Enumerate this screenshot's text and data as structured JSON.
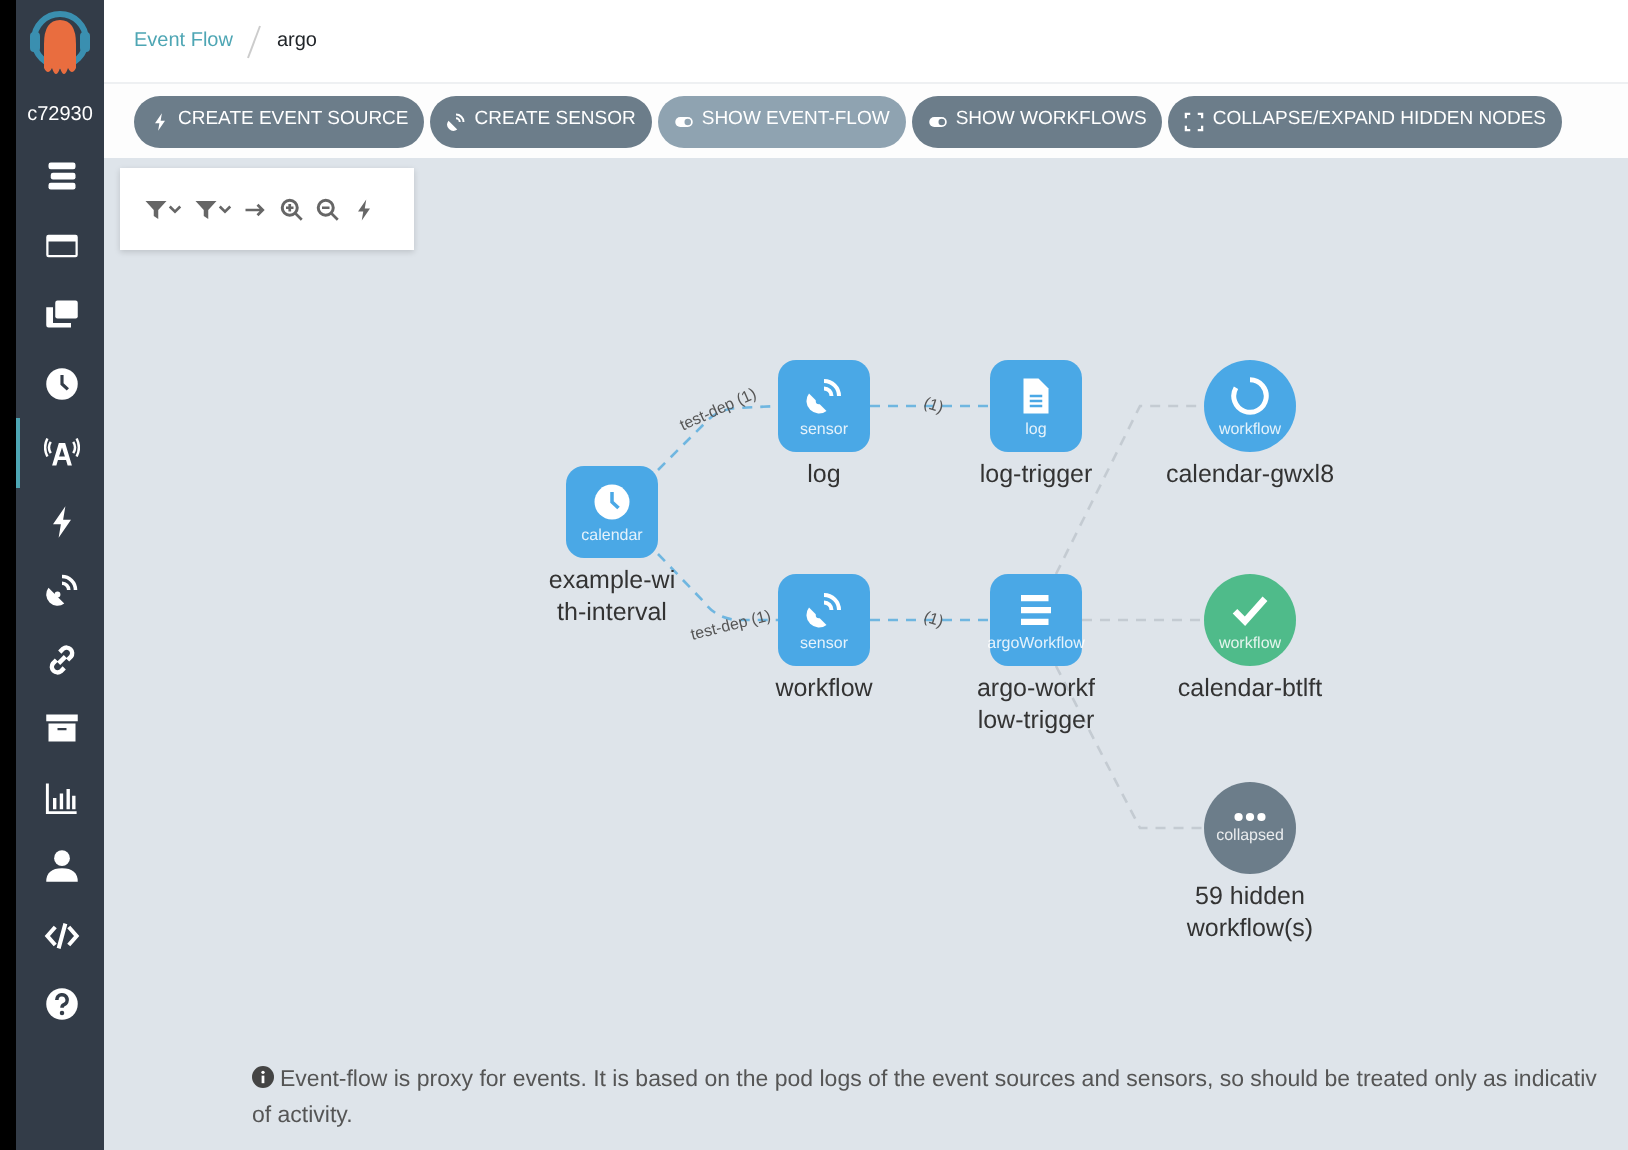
{
  "sidebar": {
    "user": "c72930",
    "items": [
      {
        "selected": false
      },
      {
        "selected": false
      },
      {
        "selected": false
      },
      {
        "selected": false
      },
      {
        "selected": true
      },
      {
        "selected": false
      },
      {
        "selected": false
      },
      {
        "selected": false
      },
      {
        "selected": false
      },
      {
        "selected": false
      },
      {
        "selected": false
      },
      {
        "selected": false
      },
      {
        "selected": false
      }
    ]
  },
  "breadcrumb": [
    "Event Flow",
    "argo"
  ],
  "toolbar": [
    {
      "label": "CREATE EVENT SOURCE",
      "kind": "action"
    },
    {
      "label": "CREATE SENSOR",
      "kind": "action"
    },
    {
      "label": "SHOW EVENT-FLOW",
      "kind": "toggle",
      "on": true
    },
    {
      "label": "SHOW WORKFLOWS",
      "kind": "toggle",
      "on": false
    },
    {
      "label": "COLLAPSE/EXPAND HIDDEN NODES",
      "kind": "action"
    }
  ],
  "graph": {
    "nodes": [
      {
        "kind": "event-source",
        "type": "calendar",
        "label_lines": [
          "example-wi",
          "th-interval"
        ]
      },
      {
        "kind": "sensor",
        "type": "sensor",
        "label_lines": [
          "log"
        ]
      },
      {
        "kind": "sensor",
        "type": "sensor",
        "label_lines": [
          "workflow"
        ]
      },
      {
        "kind": "trigger",
        "type": "log",
        "label_lines": [
          "log-trigger"
        ]
      },
      {
        "kind": "trigger",
        "type": "argoWorkflow",
        "label_lines": [
          "argo-workf",
          "low-trigger"
        ]
      },
      {
        "kind": "workflow",
        "type": "workflow",
        "succeeded": false,
        "label_lines": [
          "calendar-gwxl8"
        ]
      },
      {
        "kind": "workflow",
        "type": "workflow",
        "succeeded": true,
        "label_lines": [
          "calendar-btlft"
        ]
      },
      {
        "kind": "collapsed",
        "type": "collapsed",
        "label_lines": [
          "59 hidden",
          "workflow(s)"
        ]
      }
    ],
    "edges": [
      {
        "kind": "dependency",
        "label": "test-dep (1)"
      },
      {
        "kind": "dependency",
        "label": "test-dep (1)"
      },
      {
        "kind": "dependency",
        "label": "(1)"
      },
      {
        "kind": "dependency",
        "label": "(1)"
      },
      {
        "kind": "workflow"
      },
      {
        "kind": "workflow"
      },
      {
        "kind": "workflow"
      }
    ]
  },
  "note_lines": [
    "Event-flow is proxy for events. It is based on the pod logs of the event sources and sensors, so should be treated only as indicativ",
    "of activity."
  ]
}
